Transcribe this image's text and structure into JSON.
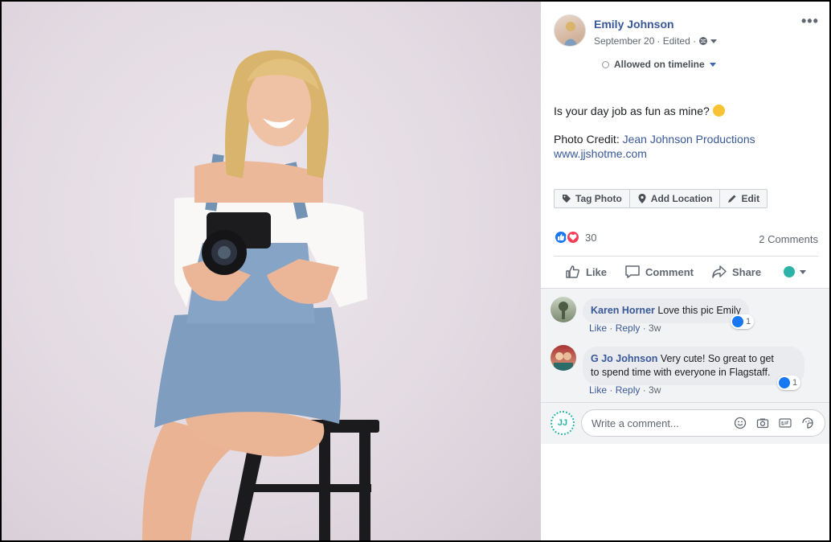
{
  "post": {
    "author": "Emily Johnson",
    "date": "September 20",
    "edited": "· Edited ·",
    "timeline": "Allowed on timeline",
    "text": "Is your day job as fun as mine?",
    "credit_label": "Photo Credit:",
    "credit_name": "Jean Johnson Productions",
    "credit_url": "www.jjshotme.com"
  },
  "photo_actions": {
    "tag": "Tag Photo",
    "location": "Add Location",
    "edit": "Edit"
  },
  "stats": {
    "reaction_count": "30",
    "comments": "2 Comments"
  },
  "action_bar": {
    "like": "Like",
    "comment": "Comment",
    "share": "Share"
  },
  "comments": [
    {
      "name": "Karen Horner",
      "text": "Love this pic Emily",
      "likes": "1",
      "like": "Like",
      "reply": "Reply",
      "time": "3w"
    },
    {
      "name": "G Jo Johnson",
      "text_line1": "Very cute! So great to get",
      "text_line2": "to spend time with everyone in Flagstaff.",
      "likes": "1",
      "like": "Like",
      "reply": "Reply",
      "time": "3w"
    }
  ],
  "composer": {
    "avatar": "JJ",
    "placeholder": "Write a comment..."
  },
  "colors": {
    "link": "#385898",
    "like_blue": "#1877f2",
    "love_red": "#f33e58",
    "brand_teal": "#2bb3a8"
  }
}
